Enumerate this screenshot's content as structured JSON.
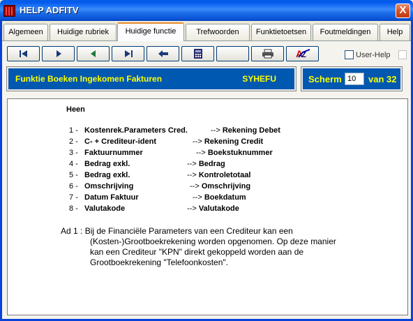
{
  "window": {
    "title": "HELP ADFITV",
    "close": "X"
  },
  "tabs": [
    {
      "label": "Algemeen"
    },
    {
      "label": "Huidige rubriek"
    },
    {
      "label": "Huidige functie"
    },
    {
      "label": "Trefwoorden"
    },
    {
      "label": "Funktietoetsen"
    },
    {
      "label": "Foutmeldingen"
    },
    {
      "label": "Help"
    }
  ],
  "toolbar": {
    "buttons": [
      {
        "icon": "first-page-icon"
      },
      {
        "icon": "play-icon"
      },
      {
        "icon": "previous-icon"
      },
      {
        "icon": "last-page-icon"
      },
      {
        "icon": "back-arrow-icon"
      },
      {
        "icon": "calculator-icon"
      },
      {
        "icon": "blank"
      },
      {
        "icon": "printer-icon"
      },
      {
        "icon": "spellcheck-icon"
      }
    ],
    "user_help_label": "User-Help"
  },
  "header": {
    "function_title": "Funktie Boeken Ingekomen Fakturen",
    "function_code": "SYHEFU",
    "screen_label": "Scherm",
    "screen_value": "10",
    "screen_total": "van 32"
  },
  "content": {
    "heading": "Heen",
    "rows": [
      {
        "num": "1 -",
        "from": "Kostenrek.Parameters Cred.",
        "arrow": "-->",
        "to": "Rekening Debet"
      },
      {
        "num": "2 -",
        "from": "C- + Crediteur-ident",
        "arrow": "-->",
        "to": "Rekening Credit"
      },
      {
        "num": "3 -",
        "from": "Faktuurnummer",
        "arrow": "-->",
        "to": "Boekstuknummer"
      },
      {
        "num": "4 -",
        "from": "Bedrag exkl.",
        "arrow": "-->",
        "to": "Bedrag"
      },
      {
        "num": "5 -",
        "from": "Bedrag exkl.",
        "arrow": "-->",
        "to": "Kontroletotaal"
      },
      {
        "num": "6 -",
        "from": "Omschrijving",
        "arrow": "-->",
        "to": "Omschrijving"
      },
      {
        "num": "7 -",
        "from": "Datum Faktuur",
        "arrow": "-->",
        "to": "Boekdatum"
      },
      {
        "num": "8 -",
        "from": "Valutakode",
        "arrow": "-->",
        "to": "Valutakode"
      }
    ],
    "notes": [
      "Ad 1 : Bij de Financiële Parameters van een Crediteur kan een",
      "         (Kosten-)Grootboekrekening worden opgenomen. Op deze manier",
      "         kan een Crediteur \"KPN\" direkt gekoppeld worden aan de",
      "         Grootboekrekening \"Telefoonkosten\"."
    ]
  }
}
